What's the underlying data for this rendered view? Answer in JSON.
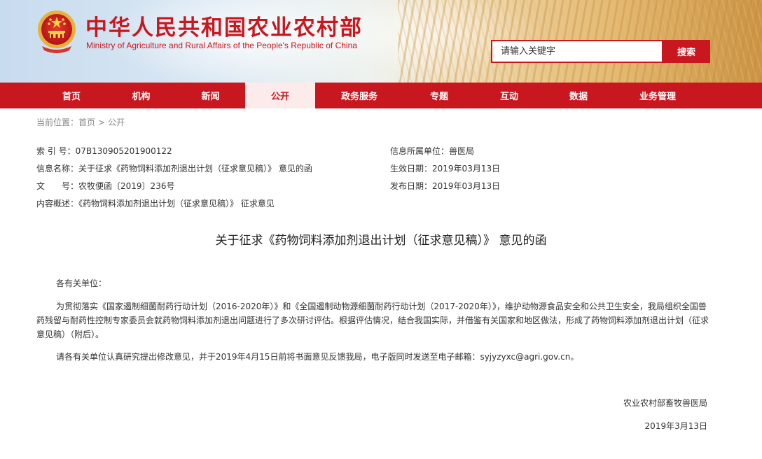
{
  "header": {
    "title_cn": "中华人民共和国农业农村部",
    "title_en": "Ministry of Agriculture and Rural Affairs of the People's Republic of China",
    "search_placeholder": "请输入关键字",
    "search_button": "搜索",
    "brand_color": "#c8171e"
  },
  "nav": {
    "items": [
      {
        "label": "首页",
        "active": false
      },
      {
        "label": "机构",
        "active": false
      },
      {
        "label": "新闻",
        "active": false
      },
      {
        "label": "公开",
        "active": true
      },
      {
        "label": "政务服务",
        "active": false
      },
      {
        "label": "专题",
        "active": false
      },
      {
        "label": "互动",
        "active": false
      },
      {
        "label": "数据",
        "active": false
      },
      {
        "label": "业务管理",
        "active": false
      }
    ]
  },
  "breadcrumb": {
    "prefix": "当前位置：",
    "items": [
      "首页",
      "公开"
    ],
    "separator": ">"
  },
  "meta": {
    "index_label": "索 引 号：",
    "index_value": "07B130905201900122",
    "info_name_label": "信息名称：",
    "info_name_value": "关于征求《药物饲料添加剂退出计划（征求意见稿）》 意见的函",
    "doc_no_label": "文　　号：",
    "doc_no_value": "农牧便函〔2019〕236号",
    "summary_label": "内容概述：",
    "summary_value": "《药物饲料添加剂退出计划（征求意见稿）》 征求意见",
    "unit_label": "信息所属单位：",
    "unit_value": "兽医局",
    "effective_label": "生效日期：",
    "effective_value": "2019年03月13日",
    "publish_label": "发布日期：",
    "publish_value": "2019年03月13日"
  },
  "article": {
    "title": "关于征求《药物饲料添加剂退出计划（征求意见稿）》 意见的函",
    "salutation": "各有关单位：",
    "paragraph1": "为贯彻落实《国家遏制细菌耐药行动计划（2016-2020年）》和《全国遏制动物源细菌耐药行动计划（2017-2020年）》，维护动物源食品安全和公共卫生安全，我局组织全国兽药残留与耐药性控制专家委员会就药物饲料添加剂退出问题进行了多次研讨评估。根据评估情况，结合我国实际，并借鉴有关国家和地区做法，形成了药物饲料添加剂退出计划（征求意见稿）（附后）。",
    "paragraph2": "请各有关单位认真研究提出修改意见，并于2019年4月15日前将书面意见反馈我局，电子版同时发送至电子邮箱：syjyzyxc@agri.gov.cn。",
    "signature_org": "农业农村部畜牧兽医局",
    "signature_date": "2019年3月13日"
  }
}
